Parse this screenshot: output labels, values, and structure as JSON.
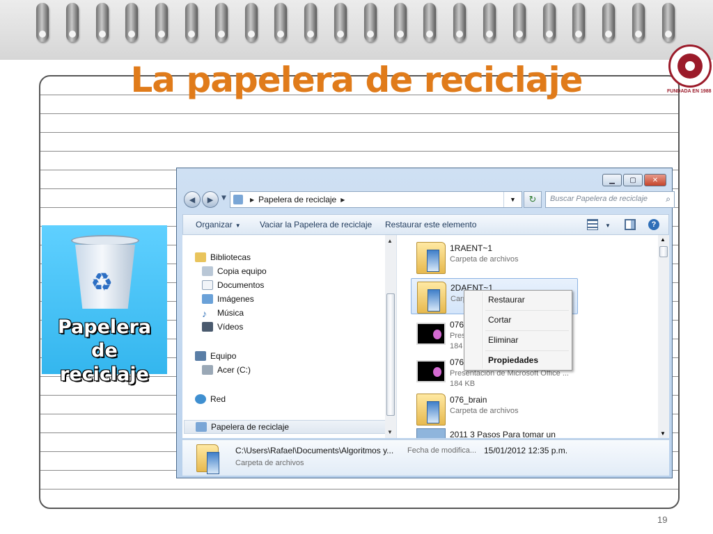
{
  "slide": {
    "title": "La papelera de reciclaje",
    "page_number": "19",
    "logo_caption": "FUNDADA EN 1988",
    "desktop_icon_label": "Papelera de reciclaje",
    "desktop_icon_label_line1": "Papelera de",
    "desktop_icon_label_line2": "reciclaje"
  },
  "window": {
    "caption_buttons": {
      "minimize": "▁",
      "maximize": "▢",
      "close": "✕"
    },
    "address": {
      "current": "Papelera de reciclaje"
    },
    "search_placeholder": "Buscar Papelera de reciclaje",
    "toolbar": {
      "organize": "Organizar",
      "empty_bin": "Vaciar la Papelera de reciclaje",
      "restore_item": "Restaurar este elemento"
    },
    "nav": {
      "libraries": "Bibliotecas",
      "items": [
        "Copia equipo",
        "Documentos",
        "Imágenes",
        "Música",
        "Vídeos"
      ],
      "computer": "Equipo",
      "drive": "Acer (C:)",
      "network": "Red",
      "recycle_bin": "Papelera de reciclaje"
    },
    "files": [
      {
        "name": "1RAENT~1",
        "type": "Carpeta de archivos"
      },
      {
        "name": "2DAENT~1",
        "type": "Carp"
      },
      {
        "name": "076",
        "type": "Pres",
        "size": "184"
      },
      {
        "name": "076",
        "type": "Presentación de Microsoft Office ...",
        "size": "184 KB"
      },
      {
        "name": "076_brain",
        "type": "Carpeta de archivos"
      },
      {
        "name": "2011 3 Pasos Para tomar un"
      }
    ],
    "context_menu": {
      "restore": "Restaurar",
      "cut": "Cortar",
      "delete": "Eliminar",
      "properties": "Propiedades"
    },
    "details": {
      "path": "C:\\Users\\Rafael\\Documents\\Algoritmos y...",
      "modified_label": "Fecha de modifica...",
      "modified_value": "15/01/2012 12:35 p.m.",
      "type": "Carpeta de archivos"
    }
  },
  "colors": {
    "title": "#e07b1a",
    "accent_blue": "#2f6fb8",
    "logo": "#9b1b2a"
  }
}
